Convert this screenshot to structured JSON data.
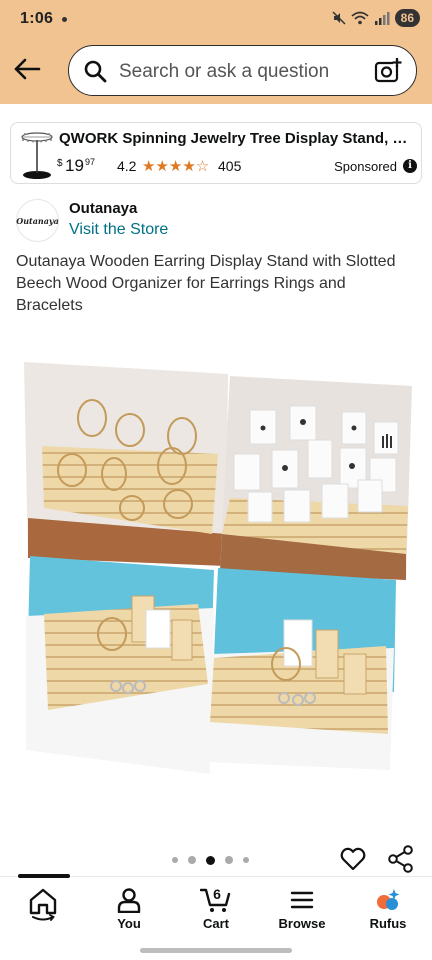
{
  "status_bar": {
    "time": "1:06",
    "battery": "86"
  },
  "search": {
    "placeholder": "Search or ask a question"
  },
  "sponsored_card": {
    "title": "QWORK Spinning Jewelry Tree Display Stand, Jewelr...",
    "price_currency": "$",
    "price_whole": "19",
    "price_fraction": "97",
    "rating": "4.2",
    "stars": "★★★★☆",
    "rating_count": "405",
    "sponsored_label": "Sponsored",
    "info_glyph": "i"
  },
  "brand": {
    "logo_text": "Outanaya",
    "name": "Outanaya",
    "store_link": "Visit the Store"
  },
  "product": {
    "title": "Outanaya Wooden Earring Display Stand with Slotted Beech Wood Organizer for Earrings Rings and Bracelets"
  },
  "carousel": {
    "total_dots": 5,
    "active_index": 2
  },
  "nav": {
    "items": [
      {
        "label": "",
        "icon": "home-icon"
      },
      {
        "label": "You",
        "icon": "user-icon"
      },
      {
        "label": "Cart",
        "icon": "cart-icon",
        "badge": "6"
      },
      {
        "label": "Browse",
        "icon": "menu-icon"
      },
      {
        "label": "Rufus",
        "icon": "rufus-icon"
      }
    ]
  },
  "colors": {
    "header_bg": "#f0c390",
    "link": "#007185",
    "star": "#de7921"
  }
}
